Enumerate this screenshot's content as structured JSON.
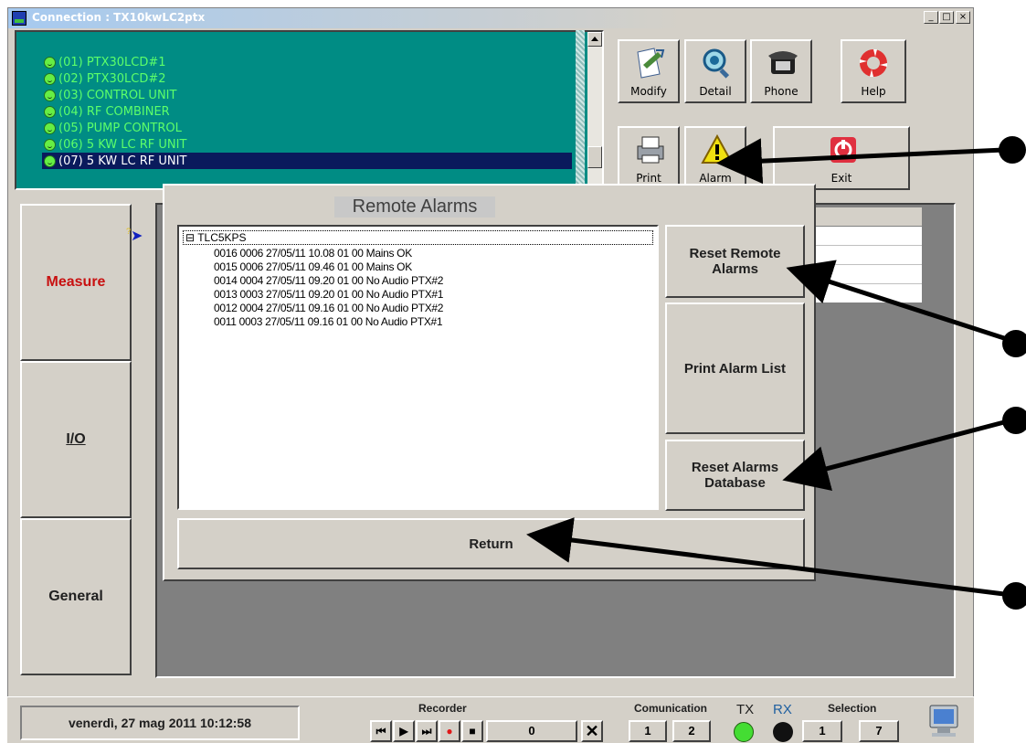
{
  "window": {
    "title": "Connection : TX10kwLC2ptx",
    "controls": [
      "_",
      "□",
      "×"
    ]
  },
  "devices": [
    "(01) PTX30LCD#1",
    "(02) PTX30LCD#2",
    "(03) CONTROL UNIT",
    "(04) RF COMBINER",
    "(05) PUMP CONTROL",
    "(06) 5 KW LC RF UNIT",
    "(07) 5 KW LC RF UNIT"
  ],
  "toolbar": {
    "modify": "Modify",
    "detail": "Detail",
    "phone": "Phone",
    "help": "Help",
    "print": "Print",
    "alarm": "Alarm",
    "exit": "Exit"
  },
  "sidetabs": {
    "measure": "Measure",
    "io": "I/O",
    "general": "General"
  },
  "dialog": {
    "title": "Remote Alarms",
    "tree_root": "TLC5KPS",
    "alarms": [
      "0016 0006 27/05/11 10.08 01 00 Mains OK",
      "0015 0006 27/05/11 09.46 01 00 Mains OK",
      "0014 0004 27/05/11 09.20 01 00 No Audio PTX#2",
      "0013 0003 27/05/11 09.20 01 00 No Audio PTX#1",
      "0012 0004 27/05/11 09.16 01 00 No Audio PTX#2",
      "0011 0003 27/05/11 09.16 01 00 No Audio PTX#1"
    ],
    "reset_remote_line1": "Reset Remote",
    "reset_remote_line2": "Alarms",
    "print_alarm_list": "Print Alarm List",
    "reset_db_line1": "Reset Alarms",
    "reset_db_line2": "Database",
    "return": "Return"
  },
  "status": {
    "datetime": "venerdì, 27 mag 2011  10:12:58",
    "recorder_label": "Recorder",
    "recorder_count": "0",
    "comunication_label": "Comunication",
    "comm_1": "1",
    "comm_2": "2",
    "tx_label": "TX",
    "rx_label": "RX",
    "selection_label": "Selection",
    "sel_1": "1",
    "sel_2": "7"
  },
  "colors": {
    "list_bg": "#008c84",
    "list_text": "#5cff6a",
    "selected_bg": "#0a1a5c",
    "measure_text": "#c81010",
    "tx_led": "#44dd33",
    "rx_led": "#111111"
  }
}
